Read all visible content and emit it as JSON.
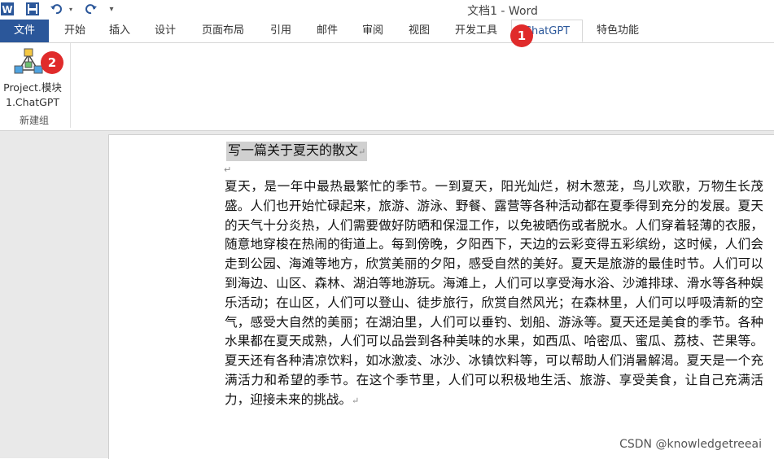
{
  "window": {
    "title": "文档1 - Word"
  },
  "quick_access": {
    "icons": [
      "word-app-icon",
      "save-icon",
      "undo-icon",
      "undo-dropdown-icon",
      "redo-icon",
      "customize-icon"
    ]
  },
  "ribbon": {
    "tabs": [
      {
        "label": "文件"
      },
      {
        "label": "开始"
      },
      {
        "label": "插入"
      },
      {
        "label": "设计"
      },
      {
        "label": "页面布局"
      },
      {
        "label": "引用"
      },
      {
        "label": "邮件"
      },
      {
        "label": "审阅"
      },
      {
        "label": "视图"
      },
      {
        "label": "开发工具"
      },
      {
        "label": "ChatGPT"
      },
      {
        "label": "特色功能"
      }
    ],
    "active_tab": "ChatGPT",
    "groups": [
      {
        "label": "新建组",
        "buttons": [
          {
            "label_line1": "Project.模块",
            "label_line2": "1.ChatGPT",
            "icon": "network-icon"
          }
        ]
      }
    ]
  },
  "markers": [
    "1",
    "2"
  ],
  "document": {
    "heading": "写一篇关于夏天的散文",
    "body": "夏天，是一年中最热最繁忙的季节。一到夏天，阳光灿烂，树木葱茏，鸟儿欢歌，万物生长茂盛。人们也开始忙碌起来，旅游、游泳、野餐、露营等各种活动都在夏季得到充分的发展。夏天的天气十分炎热，人们需要做好防晒和保湿工作，以免被晒伤或者脱水。人们穿着轻薄的衣服，随意地穿梭在热闹的街道上。每到傍晚，夕阳西下，天边的云彩变得五彩缤纷，这时候，人们会走到公园、海滩等地方，欣赏美丽的夕阳，感受自然的美好。夏天是旅游的最佳时节。人们可以到海边、山区、森林、湖泊等地游玩。海滩上，人们可以享受海水浴、沙滩排球、滑水等各种娱乐活动；在山区，人们可以登山、徒步旅行，欣赏自然风光；在森林里，人们可以呼吸清新的空气，感受大自然的美丽；在湖泊里，人们可以垂钓、划船、游泳等。夏天还是美食的季节。各种水果都在夏天成熟，人们可以品尝到各种美味的水果，如西瓜、哈密瓜、蜜瓜、荔枝、芒果等。夏天还有各种清凉饮料，如冰激凌、冰沙、冰镇饮料等，可以帮助人们消暑解渴。夏天是一个充满活力和希望的季节。在这个季节里，人们可以积极地生活、旅游、享受美食，让自己充满活力，迎接未来的挑战。",
    "paragraph_mark": "↵"
  },
  "watermark": "CSDN @knowledgetreeai",
  "colors": {
    "file_tab": "#2b579a",
    "marker": "#e02b2b",
    "selection": "#d0d0d0"
  }
}
